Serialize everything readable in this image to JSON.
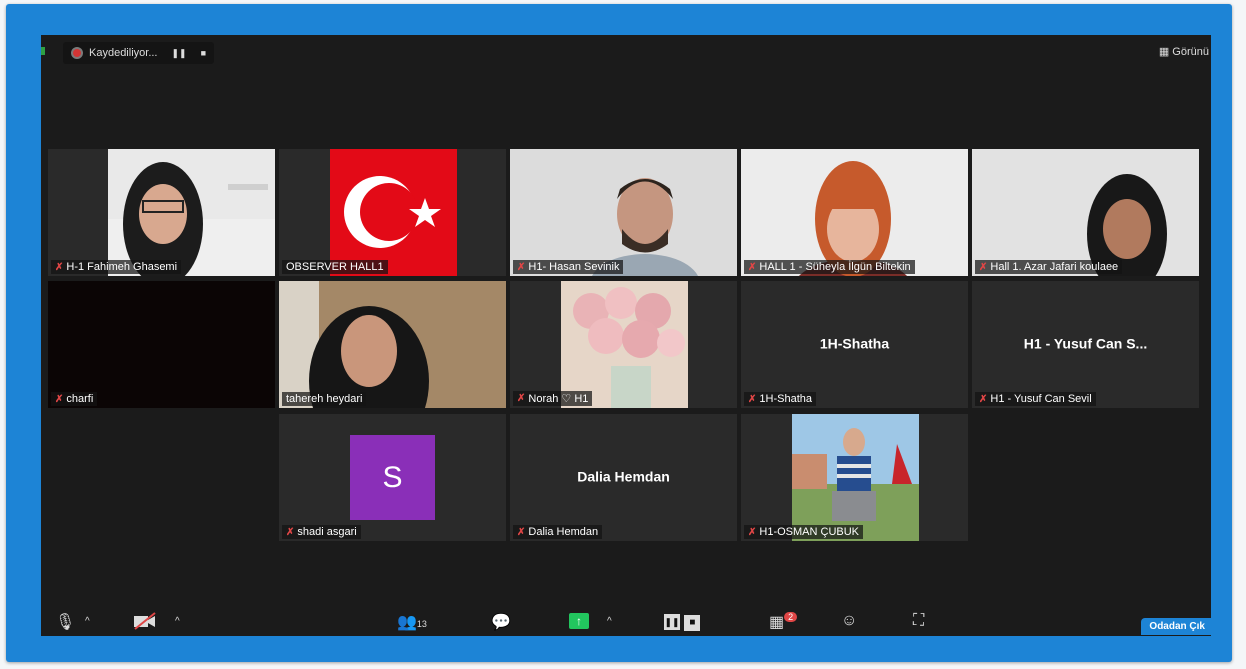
{
  "recording": {
    "label": "Kaydediliyor..."
  },
  "view_button": {
    "label": "Görünü"
  },
  "participants": [
    {
      "name": "H-1 Fahimeh Ghasemi",
      "muted": true
    },
    {
      "name": "OBSERVER HALL1",
      "muted": false
    },
    {
      "name": "H1- Hasan Sevinik",
      "muted": true
    },
    {
      "name": "HALL 1 - Süheyla İlgün Biltekin",
      "muted": true
    },
    {
      "name": "Hall 1. Azar Jafari koulaee",
      "muted": true
    },
    {
      "name": "charfi",
      "muted": true
    },
    {
      "name": "tahereh heydari",
      "muted": false,
      "active_speaker": true
    },
    {
      "name": "Norah ♡ H1",
      "muted": true
    },
    {
      "name": "1H-Shatha",
      "muted": true,
      "center_label": "1H-Shatha"
    },
    {
      "name": "H1 - Yusuf Can Sevil",
      "muted": true,
      "center_label": "H1 - Yusuf Can S..."
    },
    {
      "name": "shadi asgari",
      "muted": true,
      "avatar_letter": "S"
    },
    {
      "name": "Dalia Hemdan",
      "muted": true,
      "center_label": "Dalia Hemdan"
    },
    {
      "name": "H1-OSMAN ÇUBUK",
      "muted": true
    }
  ],
  "toolbar": {
    "participants_count": "13",
    "apps_badge": "2",
    "leave_label": "Odadan Çık"
  },
  "colors": {
    "frame": "#1d84d6",
    "screen_bg": "#1b1b1b",
    "tile_bg": "#2a2a2a",
    "active_outline": "#e8f46b",
    "avatar": "#8a2fb8",
    "share_green": "#22c55e"
  }
}
